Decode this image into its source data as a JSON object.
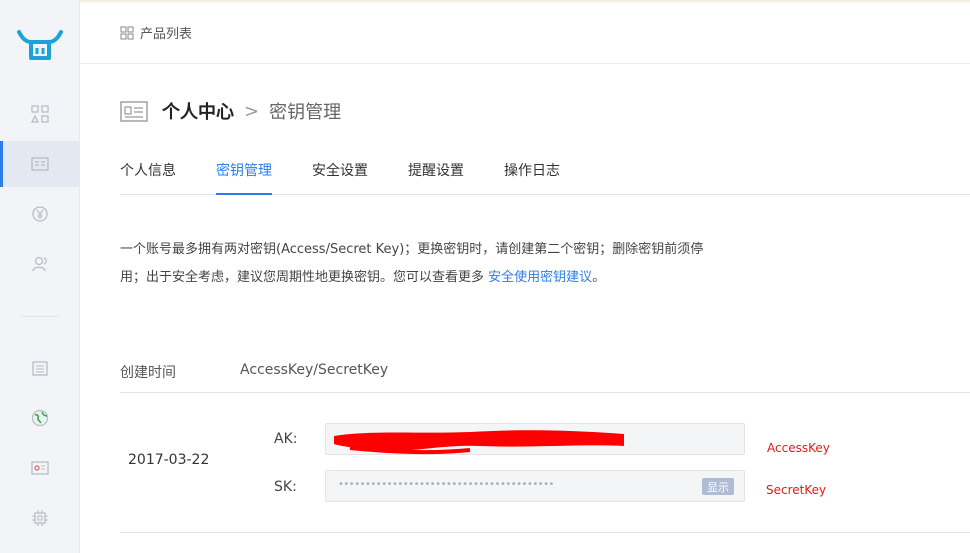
{
  "header": {
    "breadcrumb": "产品列表"
  },
  "title": {
    "main": "个人中心",
    "separator": ">",
    "sub": "密钥管理"
  },
  "tabs": [
    {
      "label": "个人信息"
    },
    {
      "label": "密钥管理",
      "active": true
    },
    {
      "label": "安全设置"
    },
    {
      "label": "提醒设置"
    },
    {
      "label": "操作日志"
    }
  ],
  "description": {
    "line1": "一个账号最多拥有两对密钥(Access/Secret Key)；更换密钥时，请创建第二个密钥；删除密钥前须停",
    "line2_prefix": "用；出于安全考虑，建议您周期性地更换密钥。您可以查看更多 ",
    "link": "安全使用密钥建议",
    "line2_suffix": "。"
  },
  "table": {
    "columns": [
      "创建时间",
      "AccessKey/SecretKey"
    ],
    "row": {
      "date": "2017-03-22",
      "ak_label": "AK:",
      "sk_label": "SK:",
      "sk_masked": "••••••••••••••••••••••••••••••••••••••••",
      "show_button": "显示"
    }
  },
  "annotations": {
    "ak_note": "AccessKey",
    "sk_note": "SecretKey"
  },
  "colors": {
    "accent": "#2b7de9",
    "annotation": "#e01a1a",
    "redaction": "#ff0000"
  }
}
